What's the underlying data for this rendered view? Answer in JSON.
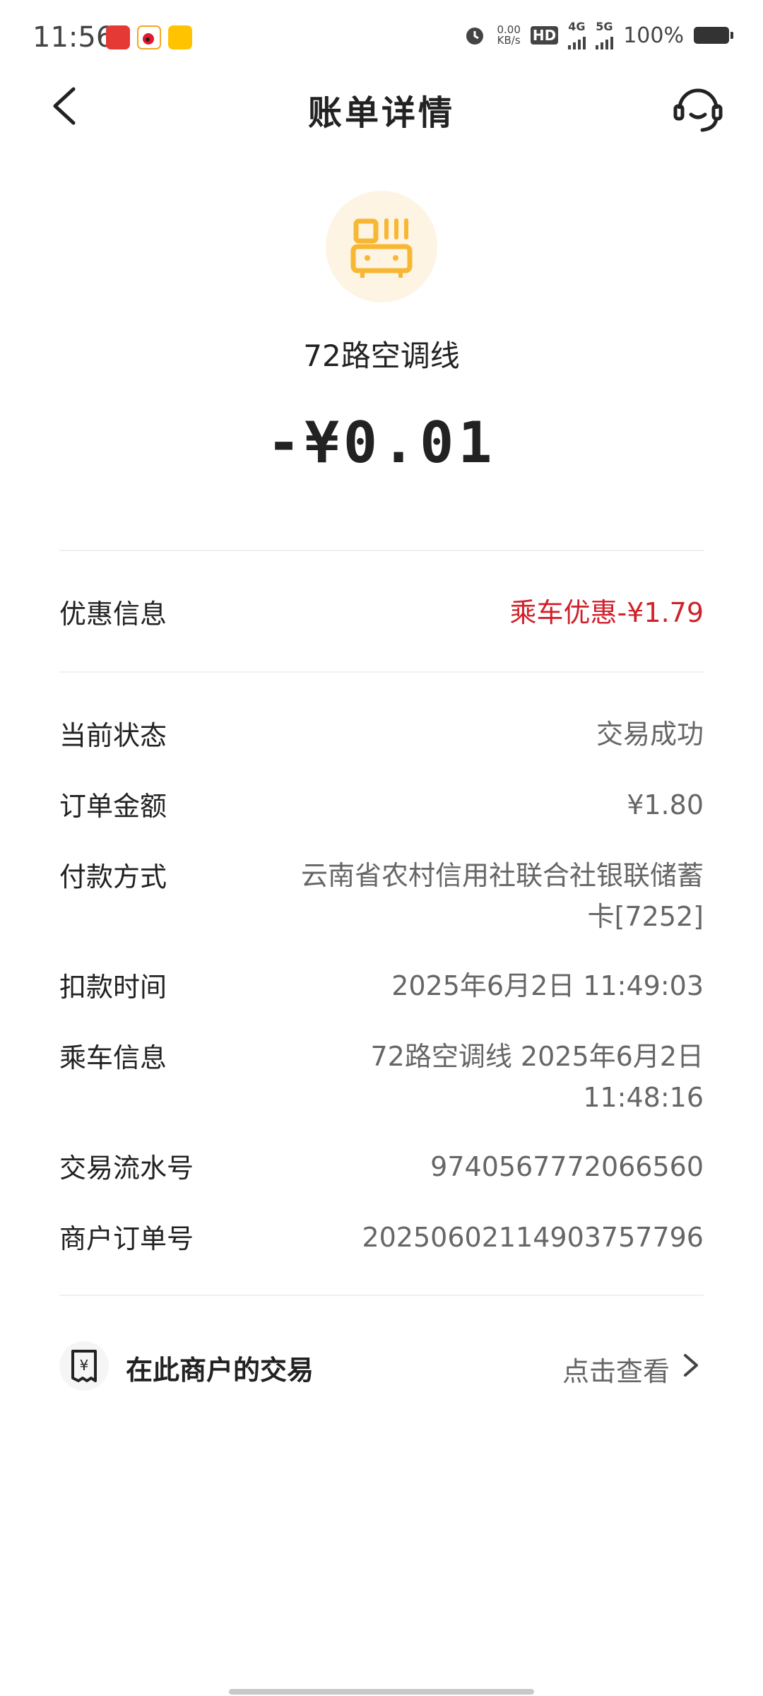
{
  "status_bar": {
    "time": "11:56",
    "net_speed_value": "0.00",
    "net_speed_unit": "KB/s",
    "hd_label": "HD",
    "network_4g": "4G",
    "network_5g": "5G",
    "battery_percent": "100%"
  },
  "header": {
    "title": "账单详情"
  },
  "merchant": {
    "name": "72路空调线",
    "amount": "-¥0.01",
    "icon_color": "#f7b733"
  },
  "discount": {
    "label": "优惠信息",
    "value": "乘车优惠-¥1.79"
  },
  "details": [
    {
      "label": "当前状态",
      "value": "交易成功"
    },
    {
      "label": "订单金额",
      "value": "¥1.80"
    },
    {
      "label": "付款方式",
      "value_line1": "云南省农村信用社联合社银联储蓄",
      "value_line2": "卡[7252]"
    },
    {
      "label": "扣款时间",
      "value": "2025年6月2日 11:49:03"
    },
    {
      "label": "乘车信息",
      "value_line1": "72路空调线 2025年6月2日",
      "value_line2": "11:48:16"
    },
    {
      "label": "交易流水号",
      "value": "9740567772066560"
    },
    {
      "label": "商户订单号",
      "value": "20250602114903757796"
    }
  ],
  "merchant_transactions": {
    "label": "在此商户的交易",
    "link": "点击查看"
  },
  "colors": {
    "discount_red": "#d0212b",
    "accent_yellow": "#f7b733"
  }
}
